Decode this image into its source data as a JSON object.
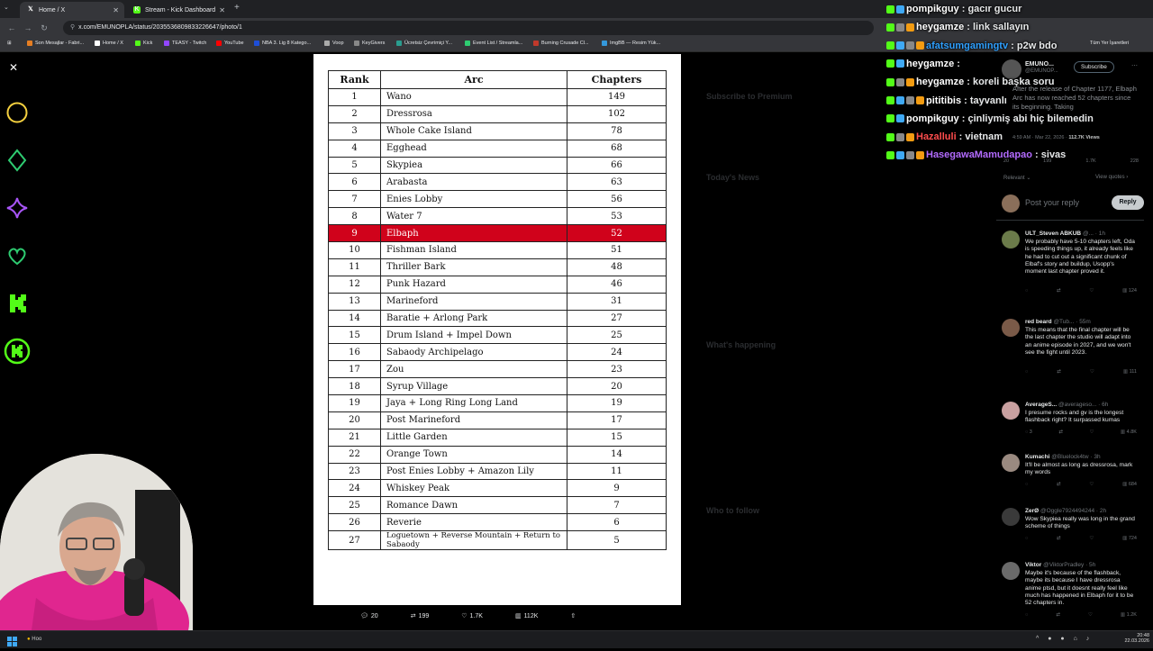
{
  "browser": {
    "tabs": [
      {
        "title": "Home / X",
        "icon": "x-logo-icon"
      },
      {
        "title": "Stream - Kick Dashboard",
        "icon": "kick-logo-icon"
      }
    ],
    "url": "x.com/EMUNOPLA/status/2035536809833226647/photo/1",
    "bookmarks": [
      "Son Mesajlar - Fabri...",
      "Home / X",
      "Kick",
      "TEASY - Twitch",
      "YouTube",
      "NBA 3. Lig 8 Katego...",
      "Voop",
      "KeyGivers",
      "Ücretsiz Çevrimiçi Y...",
      "Event List / Streamla...",
      "Burning Crusade Cl...",
      "ImgBB — Resim Yük..."
    ],
    "bookmarks_right": "Tüm Yer İşaretleri"
  },
  "image_table": {
    "headers": [
      "Rank",
      "Arc",
      "Chapters"
    ],
    "rows": [
      {
        "rank": "1",
        "arc": "Wano",
        "chapters": "149"
      },
      {
        "rank": "2",
        "arc": "Dressrosa",
        "chapters": "102"
      },
      {
        "rank": "3",
        "arc": "Whole Cake Island",
        "chapters": "78"
      },
      {
        "rank": "4",
        "arc": "Egghead",
        "chapters": "68"
      },
      {
        "rank": "5",
        "arc": "Skypiea",
        "chapters": "66"
      },
      {
        "rank": "6",
        "arc": "Arabasta",
        "chapters": "63"
      },
      {
        "rank": "7",
        "arc": "Enies Lobby",
        "chapters": "56"
      },
      {
        "rank": "8",
        "arc": "Water 7",
        "chapters": "53"
      },
      {
        "rank": "9",
        "arc": "Elbaph",
        "chapters": "52",
        "highlight": true
      },
      {
        "rank": "10",
        "arc": "Fishman Island",
        "chapters": "51"
      },
      {
        "rank": "11",
        "arc": "Thriller Bark",
        "chapters": "48"
      },
      {
        "rank": "12",
        "arc": "Punk Hazard",
        "chapters": "46"
      },
      {
        "rank": "13",
        "arc": "Marineford",
        "chapters": "31"
      },
      {
        "rank": "14",
        "arc": "Baratie + Arlong Park",
        "chapters": "27"
      },
      {
        "rank": "15",
        "arc": "Drum Island + Impel Down",
        "chapters": "25"
      },
      {
        "rank": "16",
        "arc": "Sabaody Archipelago",
        "chapters": "24"
      },
      {
        "rank": "17",
        "arc": "Zou",
        "chapters": "23"
      },
      {
        "rank": "18",
        "arc": "Syrup Village",
        "chapters": "20"
      },
      {
        "rank": "19",
        "arc": "Jaya + Long Ring Long Land",
        "chapters": "19"
      },
      {
        "rank": "20",
        "arc": "Post Marineford",
        "chapters": "17"
      },
      {
        "rank": "21",
        "arc": "Little Garden",
        "chapters": "15"
      },
      {
        "rank": "22",
        "arc": "Orange Town",
        "chapters": "14"
      },
      {
        "rank": "23",
        "arc": "Post Enies Lobby + Amazon Lily",
        "chapters": "11"
      },
      {
        "rank": "24",
        "arc": "Whiskey Peak",
        "chapters": "9"
      },
      {
        "rank": "25",
        "arc": "Romance Dawn",
        "chapters": "7"
      },
      {
        "rank": "26",
        "arc": "Reverie",
        "chapters": "6"
      },
      {
        "rank": "27",
        "arc": "Loguetown + Reverse Mountain + Return to Sabaody",
        "chapters": "5"
      }
    ],
    "highlight_color": "#d0021b"
  },
  "post_actions": {
    "replies": "20",
    "reposts": "199",
    "likes": "1.7K",
    "views": "112K"
  },
  "chat": [
    {
      "user": "pompikguy",
      "msg": "gacır gucur",
      "color": "#ffffff"
    },
    {
      "user": "heygamze",
      "msg": "link sallayın",
      "color": "#ffffff"
    },
    {
      "user": "afatsumgamingtv",
      "msg": "p2w bdo",
      "color": "#2fa0ff"
    },
    {
      "user": "heygamze",
      "msg": "",
      "color": "#ffffff"
    },
    {
      "user": "heygamze",
      "msg": "koreli başka soru",
      "color": "#ffffff"
    },
    {
      "user": "pititibis",
      "msg": "tayvanlı",
      "color": "#ffffff"
    },
    {
      "user": "pompikguy",
      "msg": "çinliymiş abi hiç bilemedin",
      "color": "#ffffff"
    },
    {
      "user": "Hazalluli",
      "msg": "vietnam",
      "color": "#ff4d4d"
    },
    {
      "user": "HasegawaMamudapao",
      "msg": "sivas",
      "color": "#b36bff"
    }
  ],
  "post": {
    "author": "EMUNO...",
    "handle": "@EMUNOP...",
    "subscribe_label": "Subscribe",
    "text": "After the release of Chapter 1177, Elbaph Arc has now reached 52 chapters since its beginning. Taking",
    "time": "4:59 AM · Mar 22, 2026",
    "views": "112.7K Views",
    "stats": [
      "20",
      "199",
      "1.7K",
      "228"
    ],
    "sort": "Relevant",
    "view_quotes": "View quotes",
    "reply_placeholder": "Post your reply",
    "reply_button": "Reply"
  },
  "replies": [
    {
      "name": "ULT_Steven ABKUB",
      "meta": "@... · 1h",
      "text": "We probably have 5-10 chapters left, Oda is speeding things up, it already feels like he had to cut out a significant chunk of Elbaf's story and buildup, Usopp's moment last chapter proved it.",
      "stats": [
        "",
        "",
        "",
        "124"
      ]
    },
    {
      "name": "red beard",
      "meta": "@Tub... · 55m",
      "text": "This means that the final chapter will be the last chapter the studio will adapt into an anime episode in 2027, and we won't see the fight until 2023.",
      "stats": [
        "",
        "",
        "",
        "111"
      ]
    },
    {
      "name": "AverageS...",
      "meta": "@averageso... · 6h",
      "text": "I presume rocks and gv is the longest flashback right? It surpassed kumas",
      "stats": [
        "3",
        "",
        "",
        "4.8K"
      ]
    },
    {
      "name": "Kumachi",
      "meta": "@Bluelock4tw · 3h",
      "text": "It'll be almost as long as dressrosa, mark my words",
      "stats": [
        "",
        "",
        "",
        "684"
      ]
    },
    {
      "name": "ZerØ",
      "meta": "@Oggle7924494244 · 2h",
      "text": "Wow Skypiea really was long in the grand scheme of things",
      "stats": [
        "",
        "",
        "",
        "724"
      ]
    },
    {
      "name": "Viktor",
      "meta": "@ViktorPradley · 5h",
      "text": "Maybe it's because of the flashback, maybe its because I have dressrosa anime ptsd, but it doesnt really feel like much has happened in Elbaph for it to be 52 chapters in.",
      "stats": [
        "",
        "",
        "",
        "1.2K"
      ]
    }
  ],
  "background_headings": {
    "premium": "Subscribe to Premium",
    "news": "Today's News",
    "happening": "What's happening",
    "follow": "Who to follow"
  },
  "taskbar": {
    "time": "20:48",
    "date": "22.03.2026",
    "search": "Hoo"
  }
}
